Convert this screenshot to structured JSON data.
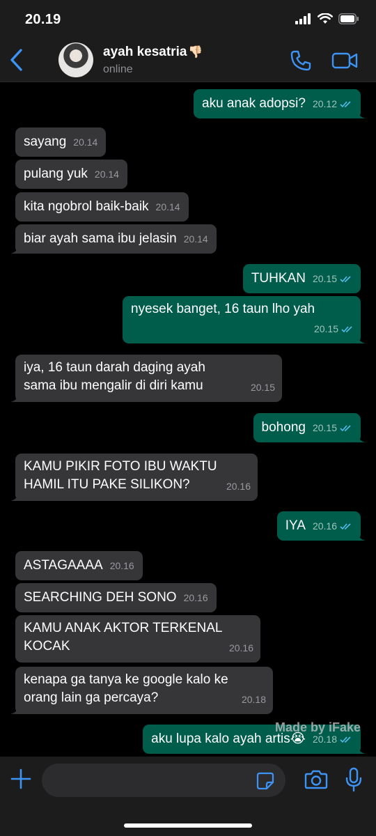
{
  "status_bar": {
    "time": "20.19"
  },
  "header": {
    "contact_name": "ayah kesatria",
    "contact_emoji": "👎🏻",
    "contact_status": "online"
  },
  "messages": [
    {
      "dir": "out",
      "text": "aku anak adopsi?",
      "time": "20.12",
      "read": true
    },
    {
      "dir": "in",
      "text": "sayang",
      "time": "20.14"
    },
    {
      "dir": "in",
      "text": "pulang yuk",
      "time": "20.14"
    },
    {
      "dir": "in",
      "text": "kita ngobrol baik-baik",
      "time": "20.14"
    },
    {
      "dir": "in",
      "text": "biar ayah sama ibu jelasin",
      "time": "20.14"
    },
    {
      "dir": "out",
      "text": "TUHKAN",
      "time": "20.15",
      "read": true
    },
    {
      "dir": "out",
      "text": "nyesek banget, 16 taun lho yah",
      "time": "20.15",
      "read": true
    },
    {
      "dir": "in",
      "lines": [
        "iya, 16 taun darah daging ayah",
        "sama ibu mengalir di diri kamu"
      ],
      "time": "20.15"
    },
    {
      "dir": "out",
      "text": "bohong",
      "time": "20.15",
      "read": true
    },
    {
      "dir": "in",
      "lines": [
        "KAMU PIKIR FOTO IBU WAKTU",
        "HAMIL ITU PAKE SILIKON?"
      ],
      "time": "20.16"
    },
    {
      "dir": "out",
      "text": "IYA",
      "time": "20.16",
      "read": true
    },
    {
      "dir": "in",
      "text": "ASTAGAAAA",
      "time": "20.16"
    },
    {
      "dir": "in",
      "text": "SEARCHING DEH SONO",
      "time": "20.16"
    },
    {
      "dir": "in",
      "lines": [
        "KAMU ANAK AKTOR TERKENAL",
        "KOCAK"
      ],
      "time": "20.16"
    },
    {
      "dir": "in",
      "lines": [
        "kenapa ga tanya ke google kalo ke",
        "orang lain ga percaya?"
      ],
      "time": "20.18"
    },
    {
      "dir": "out",
      "text": "aku lupa kalo ayah artis😭",
      "time": "20.18",
      "read": true
    }
  ],
  "watermark": "Made by iFake",
  "input": {
    "placeholder": ""
  },
  "colors": {
    "incoming_bubble": "#363638",
    "outgoing_bubble": "#005c4b",
    "accent_blue": "#3d94f6",
    "read_ticks": "#53bdeb"
  },
  "icons": [
    "back-icon",
    "phone-icon",
    "video-icon",
    "plus-icon",
    "sticker-icon",
    "camera-icon",
    "mic-icon",
    "signal-icon",
    "wifi-icon",
    "battery-icon"
  ]
}
